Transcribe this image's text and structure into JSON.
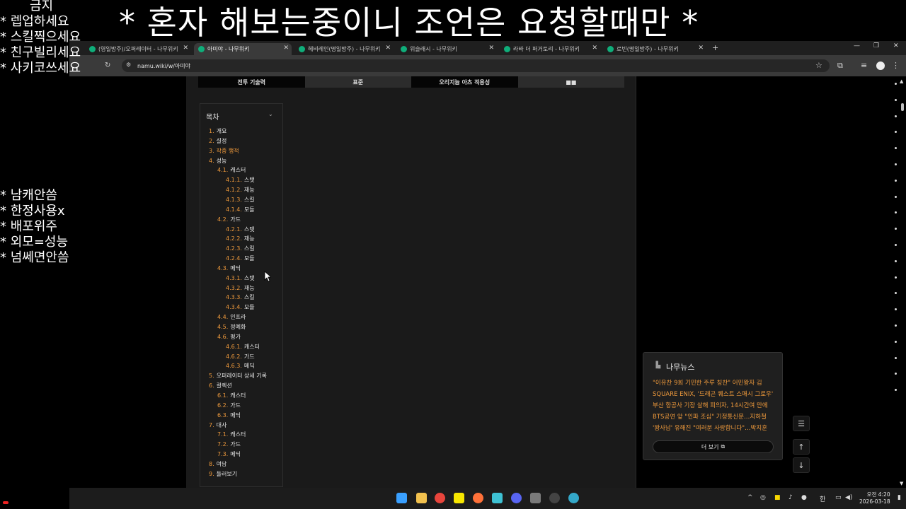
{
  "overlay": {
    "banner": "* 혼자 해보는중이니 조언은 요청할때만 *",
    "rules_top": [
      "금지",
      "* 렙업하세요",
      "* 스킬찍으세요",
      "* 친구빌리세요",
      "* 사키코쓰세요"
    ],
    "rules_mid": [
      "* 남캐안씀",
      "* 한정사용x",
      "* 배포위주",
      "* 외모=성능",
      "* 넘쎄면안씀"
    ]
  },
  "browser": {
    "tabs": [
      {
        "label": "(영일방주)/오퍼레이터 - 나무위키"
      },
      {
        "label": "아미야 - 나무위키"
      },
      {
        "label": "헤비레인(명일방주) - 나무위키"
      },
      {
        "label": "위슬래시 - 나무위키"
      },
      {
        "label": "라바 더 퍼거토리 - 나무위키"
      },
      {
        "label": "로빈(명일방주) - 나무위키"
      }
    ],
    "url": "namu.wiki/w/아미야"
  },
  "page": {
    "table_tabs": [
      "전투 기술력",
      "표준",
      "오리지늄 아츠 적응성",
      "■■"
    ],
    "toc_title": "목차",
    "toc": [
      {
        "num": "1.",
        "label": "개요",
        "level": 0
      },
      {
        "num": "2.",
        "label": "설정",
        "level": 0
      },
      {
        "num": "3.",
        "label": "작중 행적",
        "level": 0
      },
      {
        "num": "4.",
        "label": "성능",
        "level": 0
      },
      {
        "num": "4.1.",
        "label": "캐스터",
        "level": 1
      },
      {
        "num": "4.1.1.",
        "label": "스탯",
        "level": 2
      },
      {
        "num": "4.1.2.",
        "label": "재능",
        "level": 2
      },
      {
        "num": "4.1.3.",
        "label": "스킬",
        "level": 2
      },
      {
        "num": "4.1.4.",
        "label": "모듈",
        "level": 2
      },
      {
        "num": "4.2.",
        "label": "가드",
        "level": 1
      },
      {
        "num": "4.2.1.",
        "label": "스탯",
        "level": 2
      },
      {
        "num": "4.2.2.",
        "label": "재능",
        "level": 2
      },
      {
        "num": "4.2.3.",
        "label": "스킬",
        "level": 2
      },
      {
        "num": "4.2.4.",
        "label": "모듈",
        "level": 2
      },
      {
        "num": "4.3.",
        "label": "메딕",
        "level": 1
      },
      {
        "num": "4.3.1.",
        "label": "스탯",
        "level": 2
      },
      {
        "num": "4.3.2.",
        "label": "재능",
        "level": 2
      },
      {
        "num": "4.3.3.",
        "label": "스킬",
        "level": 2
      },
      {
        "num": "4.3.4.",
        "label": "모듈",
        "level": 2
      },
      {
        "num": "4.4.",
        "label": "인프라",
        "level": 1
      },
      {
        "num": "4.5.",
        "label": "정예화",
        "level": 1
      },
      {
        "num": "4.6.",
        "label": "평가",
        "level": 1
      },
      {
        "num": "4.6.1.",
        "label": "캐스터",
        "level": 2
      },
      {
        "num": "4.6.2.",
        "label": "가드",
        "level": 2
      },
      {
        "num": "4.6.3.",
        "label": "메딕",
        "level": 2
      },
      {
        "num": "5.",
        "label": "오퍼레이터 상세 기록",
        "level": 0
      },
      {
        "num": "6.",
        "label": "컬렉션",
        "level": 0
      },
      {
        "num": "6.1.",
        "label": "캐스터",
        "level": 1
      },
      {
        "num": "6.2.",
        "label": "가드",
        "level": 1
      },
      {
        "num": "6.3.",
        "label": "메딕",
        "level": 1
      },
      {
        "num": "7.",
        "label": "대사",
        "level": 0
      },
      {
        "num": "7.1.",
        "label": "캐스터",
        "level": 1
      },
      {
        "num": "7.2.",
        "label": "가드",
        "level": 1
      },
      {
        "num": "7.3.",
        "label": "메딕",
        "level": 1
      },
      {
        "num": "8.",
        "label": "여담",
        "level": 0
      },
      {
        "num": "9.",
        "label": "둘러보기",
        "level": 0
      }
    ]
  },
  "news": {
    "title": "나무뉴스",
    "items": [
      "\"이유찬 9회 기민한 주루 칭찬\" 어민왕자 김",
      "SQUARE ENIX, '드래곤 퀘스트 스매시 그로우'",
      "부산 항공사 기장 살해 피의자, 14시간여 만에",
      "BTS공연 앞 \"인파 조심\" 기정통신문…지하철",
      "'왕사남' 유해진 \"여러분 사랑합니다\"…박지훈"
    ],
    "more_label": "더 보기"
  },
  "taskbar": {
    "ime": "한",
    "time": "오전 4:20",
    "date": "2026-03-18"
  },
  "colors": {
    "accent": "#ef9a3c",
    "namu_green": "#0fae7a"
  }
}
